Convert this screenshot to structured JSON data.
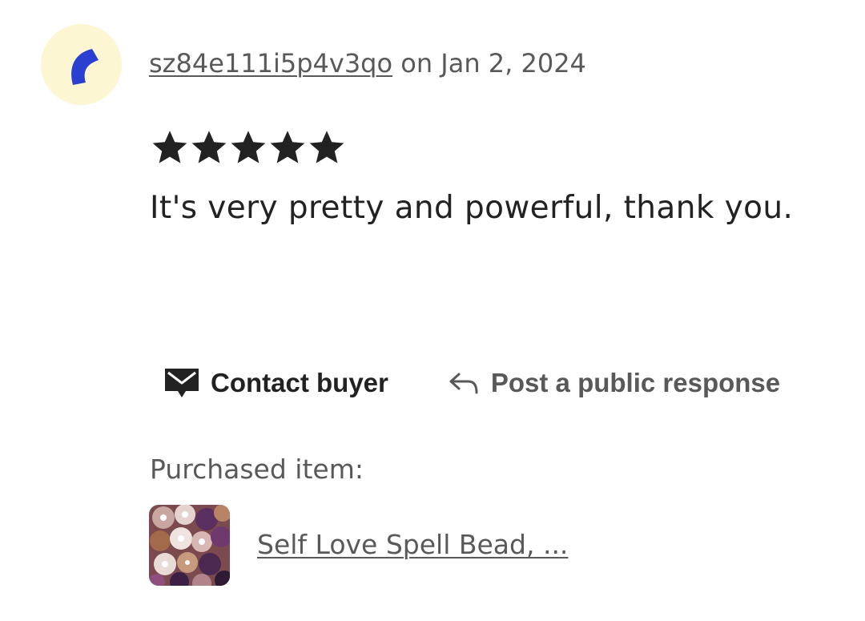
{
  "review": {
    "avatar_icon": "crescent-arc-icon",
    "avatar_colors": {
      "background": "#fdf6d3",
      "mark": "#2b3fd1"
    },
    "username": "sz84e111i5p4v3qo",
    "date_text": "on Jan 2, 2024",
    "rating": 5,
    "rating_max": 5,
    "text": "It's very pretty and powerful, thank you."
  },
  "actions": {
    "contact": {
      "icon": "envelope-icon",
      "label": "Contact buyer"
    },
    "respond": {
      "icon": "reply-arrow-icon",
      "label": "Post a public response"
    }
  },
  "purchase": {
    "label": "Purchased item:",
    "thumbnail_icon": "product-thumbnail",
    "item_title": "Self Love Spell Bead, ..."
  }
}
